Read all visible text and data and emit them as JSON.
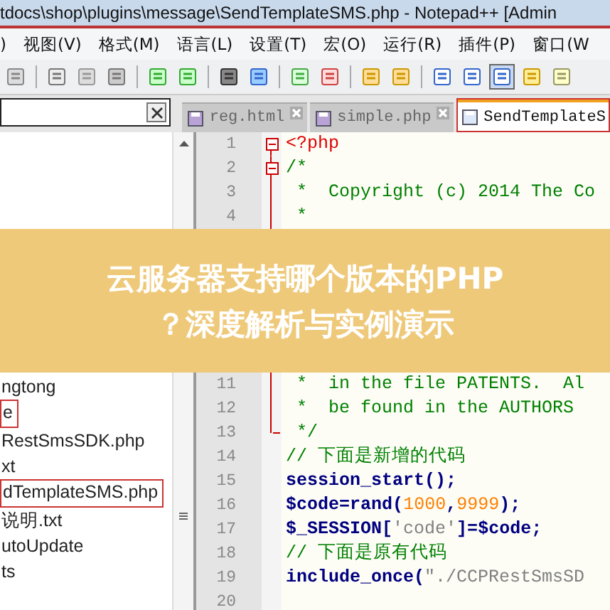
{
  "window": {
    "title": "tdocs\\shop\\plugins\\message\\SendTemplateSMS.php - Notepad++ [Admin"
  },
  "menu": [
    {
      "label": ")"
    },
    {
      "label": "视图(V)"
    },
    {
      "label": "格式(M)"
    },
    {
      "label": "语言(L)"
    },
    {
      "label": "设置(T)"
    },
    {
      "label": "宏(O)"
    },
    {
      "label": "运行(R)"
    },
    {
      "label": "插件(P)"
    },
    {
      "label": "窗口(W"
    }
  ],
  "toolbar": [
    {
      "pressed": false
    },
    {
      "pressed": false
    },
    {
      "pressed": false
    },
    {
      "pressed": false
    },
    {
      "pressed": false
    },
    {
      "pressed": false
    },
    {
      "pressed": false
    },
    {
      "pressed": false
    },
    {
      "pressed": false
    },
    {
      "pressed": false
    },
    {
      "pressed": false
    },
    {
      "pressed": false
    },
    {
      "pressed": false
    },
    {
      "pressed": false
    },
    {
      "pressed": true
    },
    {
      "pressed": false
    },
    {
      "pressed": false
    }
  ],
  "tabs": [
    {
      "label": "reg.html",
      "selected": false
    },
    {
      "label": "simple.php",
      "selected": false
    },
    {
      "label": "SendTemplateS",
      "selected": true
    }
  ],
  "code_top": [
    {
      "number": "1",
      "fold_start": true,
      "fold_end": false,
      "parts": [
        {
          "kind": "tag",
          "text": "<?php"
        }
      ]
    },
    {
      "number": "2",
      "fold_start": true,
      "fold_end": false,
      "parts": [
        {
          "kind": "comment",
          "text": "/*"
        }
      ]
    },
    {
      "number": "3",
      "fold_start": false,
      "fold_end": false,
      "parts": [
        {
          "kind": "comment",
          "text": " *  Copyright (c) 2014 The Co"
        }
      ]
    },
    {
      "number": "4",
      "fold_start": false,
      "fold_end": false,
      "parts": [
        {
          "kind": "comment",
          "text": " *"
        }
      ]
    }
  ],
  "banner": {
    "lines": [
      "云服务器支持哪个版本的PHP",
      "？深度解析与实例演示"
    ]
  },
  "files": [
    {
      "name": "ngtong",
      "boxed": false
    },
    {
      "name": "e",
      "boxed": true
    },
    {
      "name": "RestSmsSDK.php",
      "boxed": false
    },
    {
      "name": "xt",
      "boxed": false
    },
    {
      "name": "dTemplateSMS.php",
      "boxed": true
    },
    {
      "name": "说明.txt",
      "boxed": false
    },
    {
      "name": "utoUpdate",
      "boxed": false
    },
    {
      "name": "ts",
      "boxed": false
    }
  ],
  "code_bottom": [
    {
      "number": "11",
      "fold_start": false,
      "fold_end": false,
      "parts": [
        {
          "kind": "comment",
          "text": " *  in the file PATENTS.  Al"
        }
      ]
    },
    {
      "number": "12",
      "fold_start": false,
      "fold_end": false,
      "parts": [
        {
          "kind": "comment",
          "text": " *  be found in the AUTHORS"
        }
      ]
    },
    {
      "number": "13",
      "fold_start": false,
      "fold_end": true,
      "parts": [
        {
          "kind": "comment",
          "text": " */"
        }
      ]
    },
    {
      "number": "14",
      "fold_start": false,
      "fold_end": false,
      "parts": [
        {
          "kind": "comment",
          "text": "// 下面是新增的代码"
        }
      ]
    },
    {
      "number": "15",
      "fold_start": false,
      "fold_end": false,
      "parts": [
        {
          "kind": "code",
          "text": "session_start"
        },
        {
          "kind": "op",
          "text": "();"
        }
      ]
    },
    {
      "number": "16",
      "fold_start": false,
      "fold_end": false,
      "parts": [
        {
          "kind": "code",
          "text": "$code"
        },
        {
          "kind": "op",
          "text": "="
        },
        {
          "kind": "code",
          "text": "rand"
        },
        {
          "kind": "op",
          "text": "("
        },
        {
          "kind": "number",
          "text": "1000"
        },
        {
          "kind": "op",
          "text": ","
        },
        {
          "kind": "number",
          "text": "9999"
        },
        {
          "kind": "op",
          "text": ");"
        }
      ]
    },
    {
      "number": "17",
      "fold_start": false,
      "fold_end": false,
      "parts": [
        {
          "kind": "code",
          "text": "$_SESSION"
        },
        {
          "kind": "op",
          "text": "["
        },
        {
          "kind": "string",
          "text": "'code'"
        },
        {
          "kind": "op",
          "text": "]="
        },
        {
          "kind": "code",
          "text": "$code"
        },
        {
          "kind": "op",
          "text": ";"
        }
      ]
    },
    {
      "number": "18",
      "fold_start": false,
      "fold_end": false,
      "parts": [
        {
          "kind": "comment",
          "text": "// 下面是原有代码"
        }
      ]
    },
    {
      "number": "19",
      "fold_start": false,
      "fold_end": false,
      "parts": [
        {
          "kind": "code",
          "text": "include_once"
        },
        {
          "kind": "op",
          "text": "("
        },
        {
          "kind": "string",
          "text": "\"./CCPRestSmsSD"
        }
      ]
    },
    {
      "number": "20",
      "fold_start": false,
      "fold_end": false
    }
  ]
}
